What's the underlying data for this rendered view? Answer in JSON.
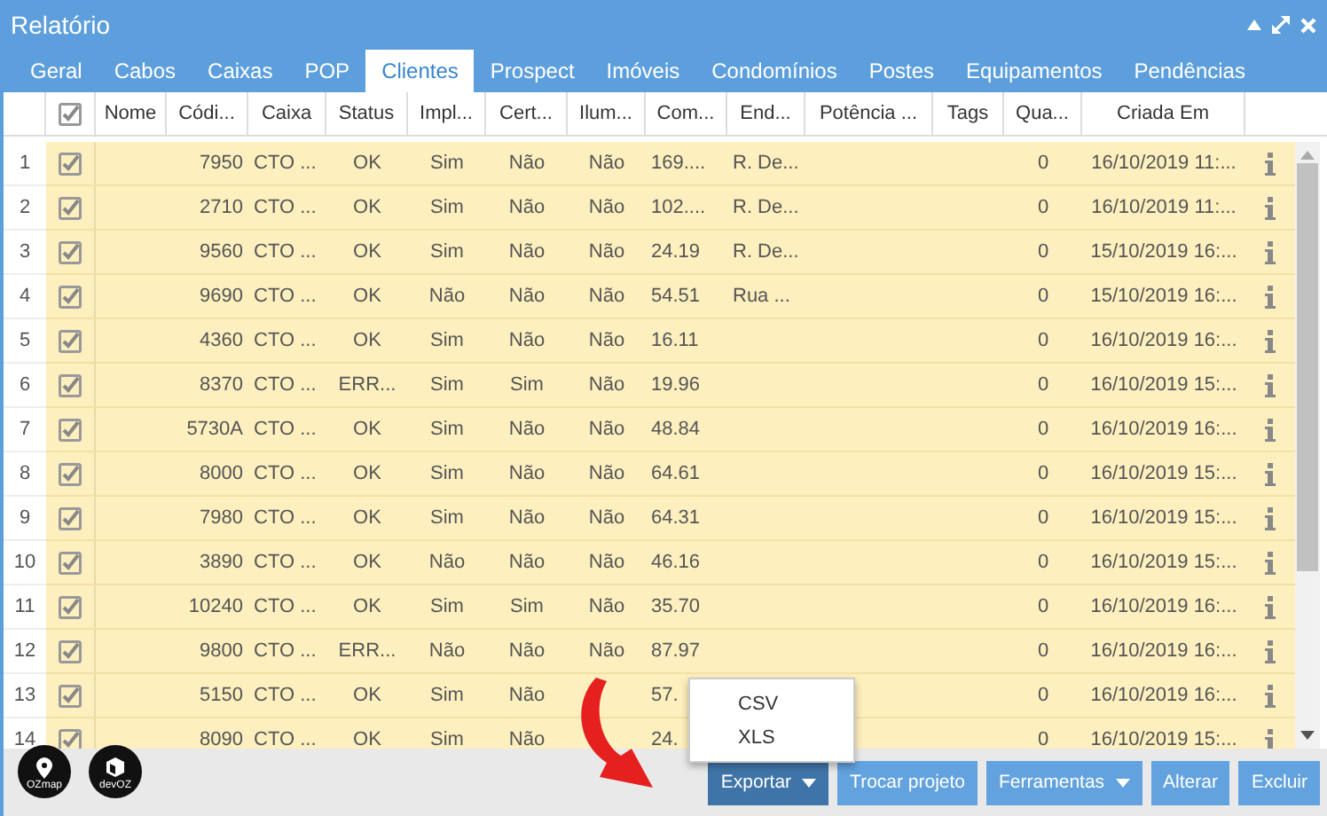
{
  "window": {
    "title": "Relatório"
  },
  "tabs": [
    {
      "label": "Geral",
      "selected": false
    },
    {
      "label": "Cabos",
      "selected": false
    },
    {
      "label": "Caixas",
      "selected": false
    },
    {
      "label": "POP",
      "selected": false
    },
    {
      "label": "Clientes",
      "selected": true
    },
    {
      "label": "Prospect",
      "selected": false
    },
    {
      "label": "Imóveis",
      "selected": false
    },
    {
      "label": "Condomínios",
      "selected": false
    },
    {
      "label": "Postes",
      "selected": false
    },
    {
      "label": "Equipamentos",
      "selected": false
    },
    {
      "label": "Pendências",
      "selected": false
    }
  ],
  "table": {
    "columns": [
      {
        "kind": "number"
      },
      {
        "kind": "check",
        "checked": true
      },
      {
        "kind": "text",
        "label": "Nome"
      },
      {
        "kind": "text",
        "label": "Códi..."
      },
      {
        "kind": "text",
        "label": "Caixa"
      },
      {
        "kind": "text",
        "label": "Status"
      },
      {
        "kind": "text",
        "label": "Impl..."
      },
      {
        "kind": "text",
        "label": "Cert..."
      },
      {
        "kind": "text",
        "label": "Ilum..."
      },
      {
        "kind": "text",
        "label": "Com..."
      },
      {
        "kind": "text",
        "label": "End..."
      },
      {
        "kind": "text",
        "label": "Potência ..."
      },
      {
        "kind": "text",
        "label": "Tags"
      },
      {
        "kind": "text",
        "label": "Qua..."
      },
      {
        "kind": "text",
        "label": "Criada Em"
      },
      {
        "kind": "info"
      }
    ],
    "rows": [
      {
        "number": "1",
        "checked": true,
        "code": "7950",
        "box": "CTO ...",
        "status": "OK",
        "impl": "Sim",
        "cert": "Não",
        "ilum": "Não",
        "com": "169....",
        "address": "R. De...",
        "qty": "0",
        "created": "16/10/2019 11:..."
      },
      {
        "number": "2",
        "checked": true,
        "code": "2710",
        "box": "CTO ...",
        "status": "OK",
        "impl": "Sim",
        "cert": "Não",
        "ilum": "Não",
        "com": "102....",
        "address": "R. De...",
        "qty": "0",
        "created": "16/10/2019 11:..."
      },
      {
        "number": "3",
        "checked": true,
        "code": "9560",
        "box": "CTO ...",
        "status": "OK",
        "impl": "Sim",
        "cert": "Não",
        "ilum": "Não",
        "com": "24.19",
        "address": "R. De...",
        "qty": "0",
        "created": "15/10/2019 16:..."
      },
      {
        "number": "4",
        "checked": true,
        "code": "9690",
        "box": "CTO ...",
        "status": "OK",
        "impl": "Não",
        "cert": "Não",
        "ilum": "Não",
        "com": "54.51",
        "address": "Rua ...",
        "qty": "0",
        "created": "15/10/2019 16:..."
      },
      {
        "number": "5",
        "checked": true,
        "code": "4360",
        "box": "CTO ...",
        "status": "OK",
        "impl": "Sim",
        "cert": "Não",
        "ilum": "Não",
        "com": "16.11",
        "qty": "0",
        "created": "16/10/2019 16:..."
      },
      {
        "number": "6",
        "checked": true,
        "code": "8370",
        "box": "CTO ...",
        "status": "ERR...",
        "impl": "Sim",
        "cert": "Sim",
        "ilum": "Não",
        "com": "19.96",
        "qty": "0",
        "created": "16/10/2019 15:..."
      },
      {
        "number": "7",
        "checked": true,
        "code": "5730A",
        "box": "CTO ...",
        "status": "OK",
        "impl": "Sim",
        "cert": "Não",
        "ilum": "Não",
        "com": "48.84",
        "qty": "0",
        "created": "16/10/2019 16:..."
      },
      {
        "number": "8",
        "checked": true,
        "code": "8000",
        "box": "CTO ...",
        "status": "OK",
        "impl": "Sim",
        "cert": "Não",
        "ilum": "Não",
        "com": "64.61",
        "qty": "0",
        "created": "16/10/2019 15:..."
      },
      {
        "number": "9",
        "checked": true,
        "code": "7980",
        "box": "CTO ...",
        "status": "OK",
        "impl": "Sim",
        "cert": "Não",
        "ilum": "Não",
        "com": "64.31",
        "qty": "0",
        "created": "16/10/2019 15:..."
      },
      {
        "number": "10",
        "checked": true,
        "code": "3890",
        "box": "CTO ...",
        "status": "OK",
        "impl": "Não",
        "cert": "Não",
        "ilum": "Não",
        "com": "46.16",
        "qty": "0",
        "created": "16/10/2019 15:..."
      },
      {
        "number": "11",
        "checked": true,
        "code": "10240",
        "box": "CTO ...",
        "status": "OK",
        "impl": "Sim",
        "cert": "Sim",
        "ilum": "Não",
        "com": "35.70",
        "qty": "0",
        "created": "16/10/2019 16:..."
      },
      {
        "number": "12",
        "checked": true,
        "code": "9800",
        "box": "CTO ...",
        "status": "ERR...",
        "impl": "Não",
        "cert": "Não",
        "ilum": "Não",
        "com": "87.97",
        "qty": "0",
        "created": "16/10/2019 16:..."
      },
      {
        "number": "13",
        "checked": true,
        "code": "5150",
        "box": "CTO ...",
        "status": "OK",
        "impl": "Sim",
        "cert": "Não",
        "com": "57.",
        "qty": "0",
        "created": "16/10/2019 16:..."
      },
      {
        "number": "14",
        "checked": true,
        "code": "8090",
        "box": "CTO ...",
        "status": "OK",
        "impl": "Sim",
        "cert": "Não",
        "com": "24.",
        "qty": "0",
        "created": "16/10/2019 15:..."
      }
    ]
  },
  "logos": [
    "OZmap",
    "devOZ"
  ],
  "export_menu": {
    "items": [
      "CSV",
      "XLS"
    ]
  },
  "buttons": [
    {
      "label": "Exportar",
      "kind": "dropdown",
      "active": true
    },
    {
      "label": "Trocar projeto",
      "kind": "plain",
      "active": false
    },
    {
      "label": "Ferramentas",
      "kind": "dropdown",
      "active": false
    },
    {
      "label": "Alterar",
      "kind": "plain",
      "active": false
    },
    {
      "label": "Excluir",
      "kind": "plain",
      "active": false
    }
  ]
}
